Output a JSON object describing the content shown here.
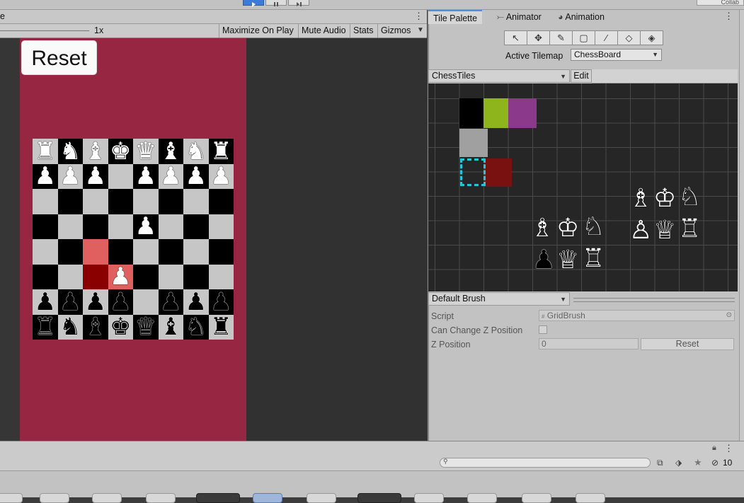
{
  "game_view": {
    "tab_label": "e",
    "scale_label": "1x",
    "toolbar": {
      "maximize": "Maximize On Play",
      "mute": "Mute Audio",
      "stats": "Stats",
      "gizmos": "Gizmos"
    },
    "reset_label": "Reset",
    "board": [
      [
        "wr",
        "wn",
        "wb",
        "wk",
        "wq",
        "wb",
        "wn",
        "wr"
      ],
      [
        "wp",
        "wp",
        "wp",
        "",
        "wp",
        "wp",
        "wp",
        "wp"
      ],
      [
        "",
        "",
        "",
        "",
        "",
        "",
        "",
        ""
      ],
      [
        "",
        "",
        "",
        "",
        "wp",
        "",
        "",
        ""
      ],
      [
        "",
        "",
        "",
        "",
        "",
        "",
        "",
        ""
      ],
      [
        "",
        "",
        "",
        "wp",
        "",
        "",
        "",
        ""
      ],
      [
        "bp",
        "bp",
        "bp",
        "bp",
        "",
        "bp",
        "bp",
        "bp"
      ],
      [
        "br",
        "bn",
        "bb",
        "bk",
        "bq",
        "bb",
        "bn",
        "br"
      ]
    ],
    "highlights": [
      {
        "row": 4,
        "col": 2,
        "color": "#e06060"
      },
      {
        "row": 5,
        "col": 2,
        "color": "#8a0000"
      },
      {
        "row": 5,
        "col": 3,
        "color": "#e06060"
      }
    ]
  },
  "colors": {
    "canvas": "#962641",
    "tile_green": "#8fb51d",
    "tile_purple": "#8b3a8b",
    "tile_gray": "#a0a0a0",
    "tile_dark_red": "#7a1111",
    "selection": "#25c6d6"
  },
  "tabs": {
    "tile_palette": "Tile Palette",
    "animator": "Animator",
    "animation": "Animation"
  },
  "tools": [
    "select-tool-icon",
    "move-tool-icon",
    "paint-brush-icon",
    "box-fill-icon",
    "picker-icon",
    "eraser-icon",
    "fill-icon"
  ],
  "palette": {
    "active_tilemap_label": "Active Tilemap",
    "active_tilemap_value": "ChessBoard",
    "palette_name": "ChessTiles",
    "edit_label": "Edit"
  },
  "brush": {
    "name": "Default Brush",
    "script_label": "Script",
    "script_value": "GridBrush",
    "z_change_label": "Can Change Z Position",
    "z_label": "Z Position",
    "z_value": "0",
    "reset_label": "Reset"
  },
  "project": {
    "hidden_count": "10"
  },
  "collab": "Collab"
}
